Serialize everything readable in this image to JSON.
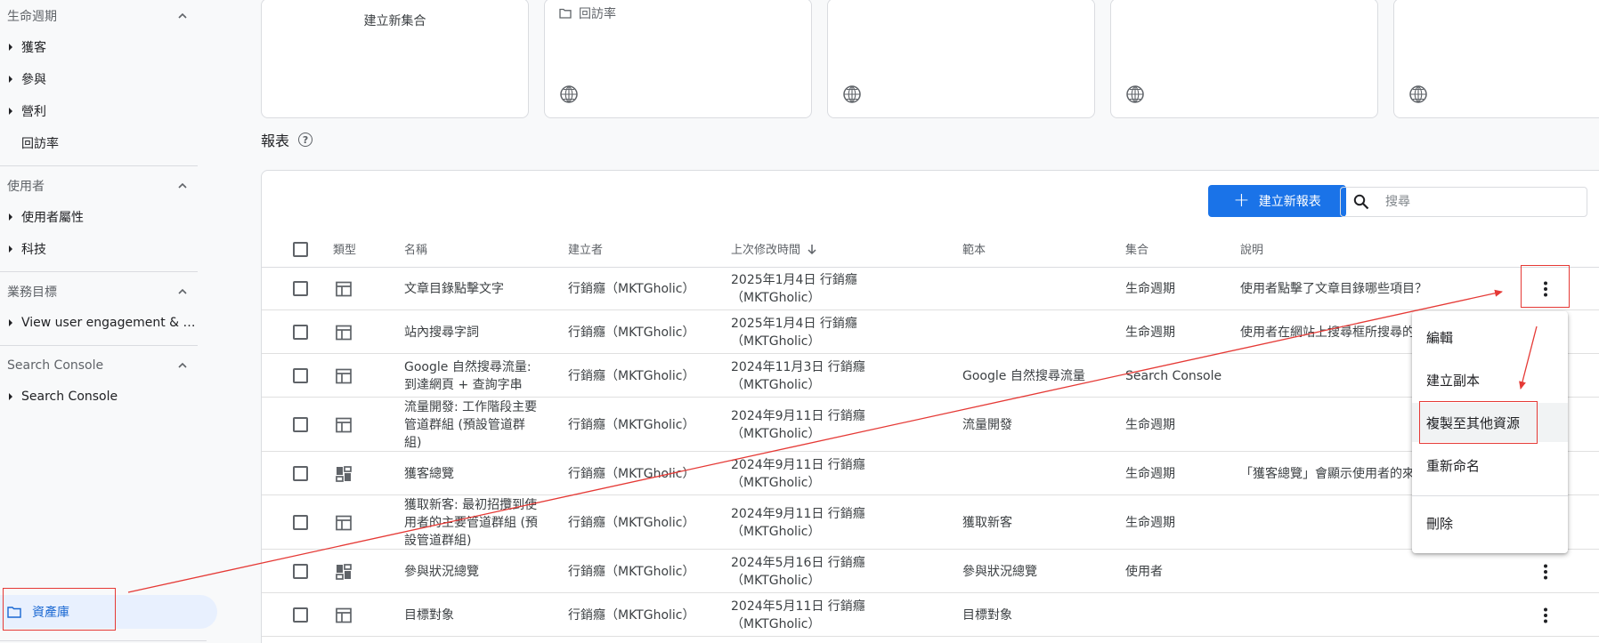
{
  "sidebar": {
    "sections": [
      {
        "title": "生命週期",
        "items": [
          {
            "label": "獲客",
            "expandable": true
          },
          {
            "label": "參與",
            "expandable": true
          },
          {
            "label": "營利",
            "expandable": true
          },
          {
            "label": "回訪率",
            "expandable": false
          }
        ]
      },
      {
        "title": "使用者",
        "items": [
          {
            "label": "使用者屬性",
            "expandable": true
          },
          {
            "label": "科技",
            "expandable": true
          }
        ]
      },
      {
        "title": "業務目標",
        "items": [
          {
            "label": "View user engagement & rete...",
            "expandable": true
          }
        ]
      },
      {
        "title": "Search Console",
        "items": [
          {
            "label": "Search Console",
            "expandable": true
          }
        ]
      }
    ],
    "library_label": "資產庫"
  },
  "collections": {
    "new_label": "建立新集合",
    "cards": [
      {
        "title": "回訪率"
      },
      {
        "title": ""
      },
      {
        "title": ""
      },
      {
        "title": ""
      }
    ]
  },
  "reports": {
    "heading": "報表",
    "create_button": "建立新報表",
    "search_placeholder": "搜尋",
    "columns": {
      "type": "類型",
      "name": "名稱",
      "creator": "建立者",
      "modified": "上次修改時間",
      "template": "範本",
      "collection": "集合",
      "description": "說明"
    },
    "rows": [
      {
        "type": "table",
        "name": [
          "文章目錄點擊文字"
        ],
        "creator": "行銷癮（MKTGholic）",
        "modified": [
          "2025年1月4日 行銷癮",
          "（MKTGholic）"
        ],
        "template": "",
        "collection": "生命週期",
        "description": "使用者點擊了文章目錄哪些項目？"
      },
      {
        "type": "table",
        "name": [
          "站內搜尋字詞"
        ],
        "creator": "行銷癮（MKTGholic）",
        "modified": [
          "2025年1月4日 行銷癮",
          "（MKTGholic）"
        ],
        "template": "",
        "collection": "生命週期",
        "description": "使用者在網站上搜尋框所搜尋的"
      },
      {
        "type": "table",
        "name": [
          "Google 自然搜尋流量:",
          "到達網頁 + 查詢字串"
        ],
        "creator": "行銷癮（MKTGholic）",
        "modified": [
          "2024年11月3日 行銷癮",
          "（MKTGholic）"
        ],
        "template": "Google 自然搜尋流量",
        "collection": "Search Console",
        "description": ""
      },
      {
        "type": "table",
        "name": [
          "流量開發: 工作階段主要",
          "管道群組 (預設管道群",
          "組)"
        ],
        "creator": "行銷癮（MKTGholic）",
        "modified": [
          "2024年9月11日 行銷癮",
          "（MKTGholic）"
        ],
        "template": "流量開發",
        "collection": "生命週期",
        "description": ""
      },
      {
        "type": "dashboard",
        "name": [
          "獲客總覽"
        ],
        "creator": "行銷癮（MKTGholic）",
        "modified": [
          "2024年9月11日 行銷癮",
          "（MKTGholic）"
        ],
        "template": "",
        "collection": "生命週期",
        "description": "「獲客總覽」會顯示使用者的來"
      },
      {
        "type": "table",
        "name": [
          "獲取新客: 最初招攬到使",
          "用者的主要管道群組 (預",
          "設管道群組)"
        ],
        "creator": "行銷癮（MKTGholic）",
        "modified": [
          "2024年9月11日 行銷癮",
          "（MKTGholic）"
        ],
        "template": "獲取新客",
        "collection": "生命週期",
        "description": ""
      },
      {
        "type": "dashboard",
        "name": [
          "參與狀況總覽"
        ],
        "creator": "行銷癮（MKTGholic）",
        "modified": [
          "2024年5月16日 行銷癮",
          "（MKTGholic）"
        ],
        "template": "參與狀況總覽",
        "collection": "使用者",
        "description": ""
      },
      {
        "type": "table",
        "name": [
          "目標對象"
        ],
        "creator": "行銷癮（MKTGholic）",
        "modified": [
          "2024年5月11日 行銷癮",
          "（MKTGholic）"
        ],
        "template": "目標對象",
        "collection": "",
        "description": ""
      }
    ]
  },
  "context_menu": {
    "items": [
      "編輯",
      "建立副本",
      "複製至其他資源",
      "重新命名",
      "刪除"
    ],
    "highlighted": "複製至其他資源"
  },
  "colors": {
    "primary": "#1a73e8",
    "library_bg": "#e8f0fe",
    "annotation": "#e53935"
  }
}
